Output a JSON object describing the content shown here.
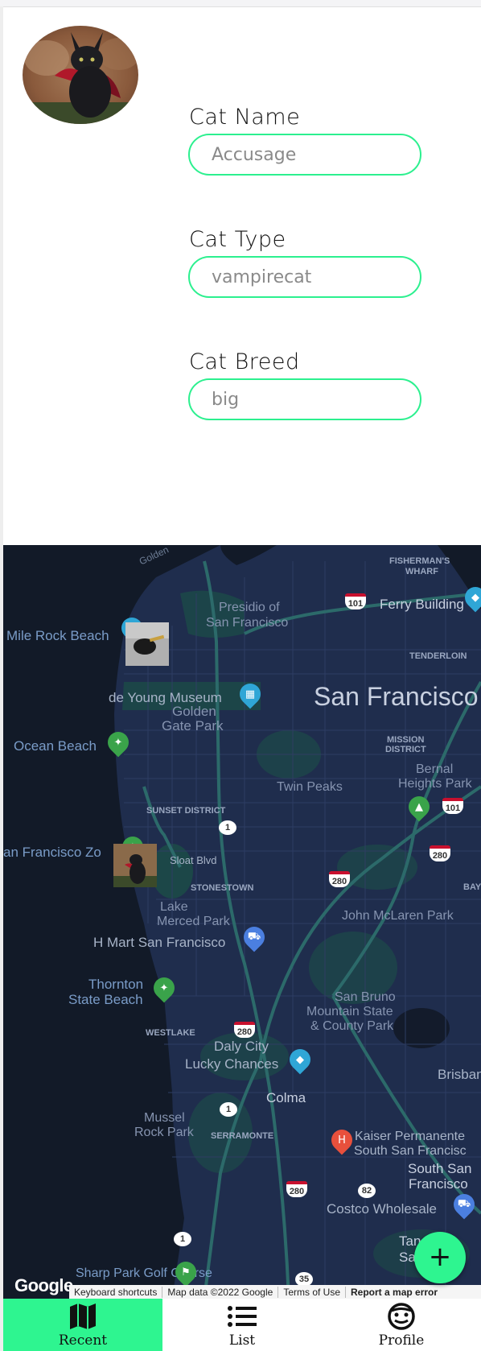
{
  "form": {
    "cat_name": {
      "label": "Cat Name",
      "placeholder": "Accusage"
    },
    "cat_type": {
      "label": "Cat Type",
      "placeholder": "vampirecat"
    },
    "cat_breed": {
      "label": "Cat Breed",
      "placeholder": "big"
    }
  },
  "map": {
    "labels": {
      "golden": "Golden",
      "fishermans": "FISHERMAN'S",
      "wharf": "WHARF",
      "presidio1": "Presidio of",
      "presidio2": "San Francisco",
      "ferry": "Ferry Building",
      "mile_rock": "Mile Rock Beach",
      "tenderloin": "TENDERLOIN",
      "de_young": "de Young Museum",
      "ggp1": "Golden",
      "ggp2": "Gate Park",
      "san_francisco": "San Francisco",
      "mission1": "MISSION",
      "mission2": "DISTRICT",
      "ocean_beach": "Ocean Beach",
      "bernal1": "Bernal",
      "bernal2": "Heights Park",
      "twin_peaks": "Twin Peaks",
      "sunset": "SUNSET DISTRICT",
      "zoo": "an Francisco Zo",
      "sloat": "Sloat Blvd",
      "bay": "BAY",
      "stonestown": "STONESTOWN",
      "lake1": "Lake",
      "lake2": "Merced Park",
      "mclaren": "John McLaren Park",
      "hmart": "H Mart San Francisco",
      "thornton1": "Thornton",
      "thornton2": "State Beach",
      "sanbruno1": "San Bruno",
      "sanbruno2": "Mountain State",
      "sanbruno3": "& County Park",
      "westlake": "WESTLAKE",
      "daly": "Daly City",
      "lucky": "Lucky Chances",
      "brisbane": "Brisban",
      "colma": "Colma",
      "mussel1": "Mussel",
      "mussel2": "Rock Park",
      "serramonte": "SERRAMONTE",
      "kaiser1": "Kaiser Permanente",
      "kaiser2": "South San Francisc",
      "ssf1": "South San",
      "ssf2": "Francisco",
      "costco": "Costco Wholesale",
      "golf": "Sharp Park Golf Course",
      "tan": "Tan",
      "san_bottom": "San"
    },
    "shields": {
      "us101_a": "101",
      "us101_b": "101",
      "i280_a": "280",
      "i280_b": "280",
      "i280_c": "280",
      "i280_d": "280",
      "ca1_a": "1",
      "ca1_b": "1",
      "ca1_c": "1",
      "ca82": "82",
      "ca35": "35"
    },
    "google": "Google",
    "attribution": {
      "shortcuts": "Keyboard shortcuts",
      "data": "Map data ©2022 Google",
      "terms": "Terms of Use",
      "report": "Report a map error"
    },
    "fab": "+"
  },
  "nav": {
    "items": [
      {
        "label": "Recent",
        "icon": "map-icon",
        "active": true
      },
      {
        "label": "List",
        "icon": "list-icon",
        "active": false
      },
      {
        "label": "Profile",
        "icon": "face-icon",
        "active": false
      }
    ]
  },
  "colors": {
    "accent": "#2ef590",
    "input_border": "#2cf08f",
    "map_land": "#1f2d4d",
    "map_water": "#111827"
  }
}
